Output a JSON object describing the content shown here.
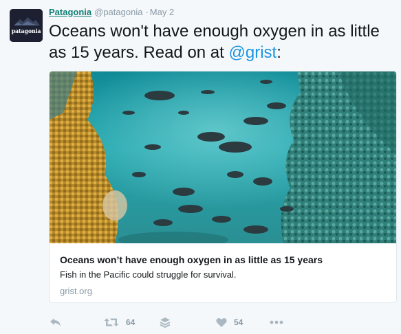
{
  "tweet": {
    "avatar_text": "patagonia",
    "name": "Patagonia",
    "handle": "@patagonia",
    "separator": "·",
    "date": "May 2",
    "text_main": "Oceans won't have enough oxygen in as little as 15 years. Read on at ",
    "mention": "@grist",
    "text_end": ":"
  },
  "card": {
    "title": "Oceans won’t have enough oxygen in as little as 15 years",
    "description": "Fish in the Pacific could struggle for survival.",
    "domain": "grist.org"
  },
  "actions": {
    "retweet_count": "64",
    "like_count": "54"
  },
  "colors": {
    "link": "#1b95e0",
    "name": "#0e7f74",
    "muted": "#8899a6",
    "water": "#1f9aa3"
  },
  "icons": [
    "reply-icon",
    "retweet-icon",
    "buffer-icon",
    "heart-icon",
    "more-icon"
  ]
}
